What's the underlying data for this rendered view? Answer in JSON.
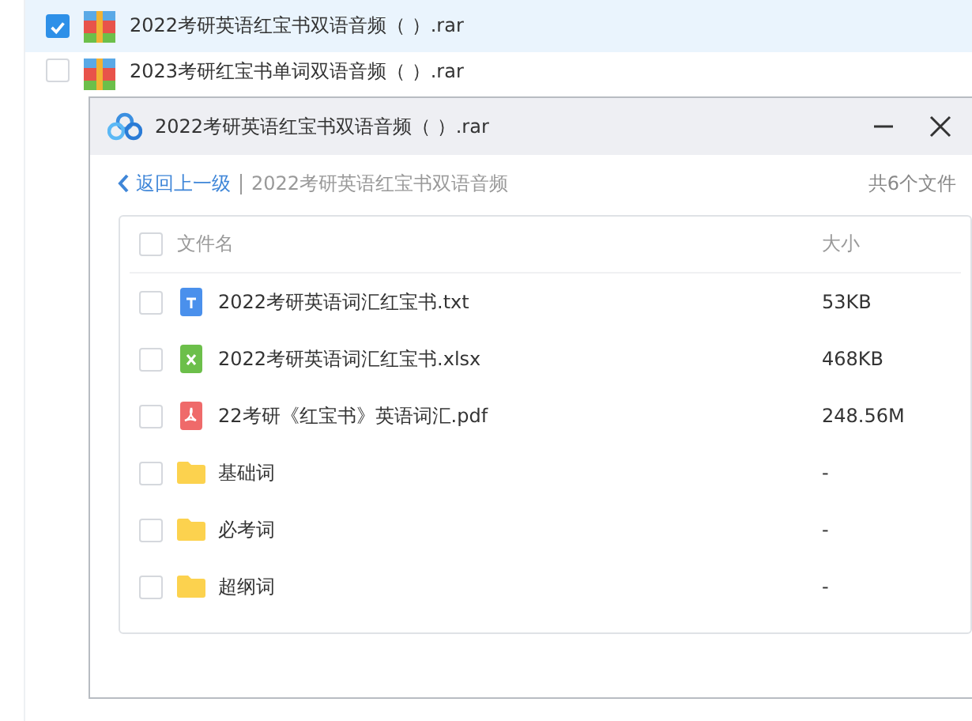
{
  "background_list": [
    {
      "name": "2022考研英语红宝书双语音频（  ）.rar",
      "checked": true,
      "selected": true
    },
    {
      "name": "2023考研红宝书单词双语音频（  ）.rar",
      "checked": false,
      "selected": false
    }
  ],
  "dialog": {
    "title": "2022考研英语红宝书双语音频（  ）.rar",
    "back": "返回上一级",
    "path": "2022考研英语红宝书双语音频",
    "count": "共6个文件",
    "columns": [
      "文件名",
      "大小"
    ],
    "header_checked": false,
    "rows": [
      {
        "kind": "txt",
        "name": "2022考研英语词汇红宝书.txt",
        "size": "53KB",
        "checked": false
      },
      {
        "kind": "xlsx",
        "name": "2022考研英语词汇红宝书.xlsx",
        "size": "468KB",
        "checked": false
      },
      {
        "kind": "pdf",
        "name": "22考研《红宝书》英语词汇.pdf",
        "size": "248.56M",
        "checked": false
      },
      {
        "kind": "folder",
        "name": "基础词",
        "size": "-",
        "checked": false
      },
      {
        "kind": "folder",
        "name": "必考词",
        "size": "-",
        "checked": false
      },
      {
        "kind": "folder",
        "name": "超纲词",
        "size": "-",
        "checked": false
      }
    ]
  }
}
